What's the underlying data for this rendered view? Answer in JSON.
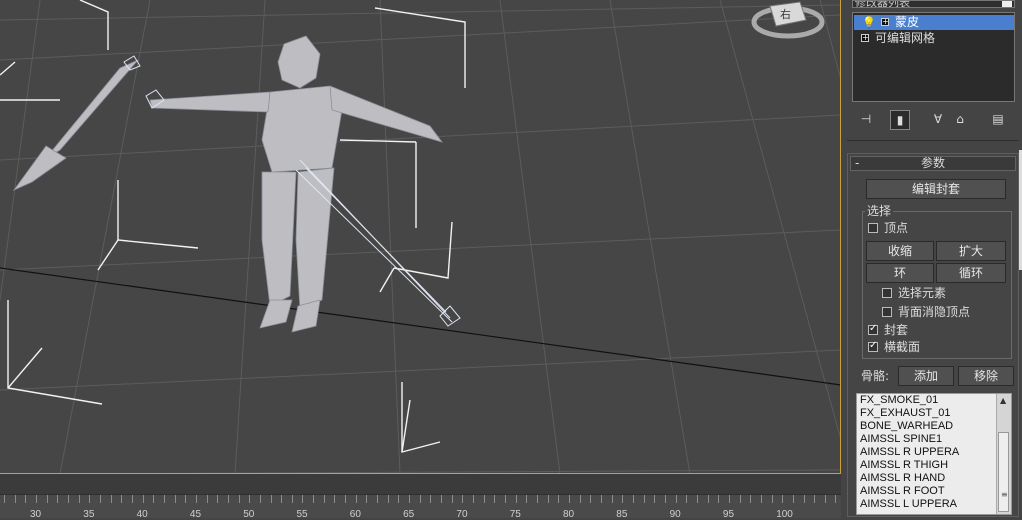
{
  "modifier_stack": {
    "list_header": "修改器列表",
    "items": [
      {
        "label": "蒙皮",
        "selected": true
      },
      {
        "label": "可编辑网格",
        "selected": false
      }
    ]
  },
  "stack_toolbar": {
    "icons": [
      "pin-stack-icon",
      "show-end-result-icon",
      "make-unique-icon",
      "remove-modifier-icon",
      "configure-sets-icon"
    ]
  },
  "rollout": {
    "collapse_symbol": "-",
    "title": "参数",
    "edit_envelope": "编辑封套",
    "selection_group": {
      "label": "选择",
      "vertex": {
        "label": "顶点",
        "checked": false
      },
      "shrink": "收缩",
      "grow": "扩大",
      "ring": "环",
      "loop": "循环",
      "select_element": {
        "label": "选择元素",
        "checked": false
      },
      "backface_cull": {
        "label": "背面消隐顶点",
        "checked": false
      },
      "envelope": {
        "label": "封套",
        "checked": true
      },
      "cross_section": {
        "label": "横截面",
        "checked": true
      }
    },
    "bones_label": "骨骼:",
    "add": "添加",
    "remove": "移除",
    "bones": [
      "FX_SMOKE_01",
      "FX_EXHAUST_01",
      "BONE_WARHEAD",
      "AIMSSL SPINE1",
      "AIMSSL R UPPERA",
      "AIMSSL R THIGH",
      "AIMSSL R HAND",
      "AIMSSL R FOOT",
      "AIMSSL L UPPERA"
    ]
  },
  "viewcube": {
    "label": "右"
  },
  "timeline": {
    "ticks": [
      "30",
      "35",
      "40",
      "45",
      "50",
      "55",
      "60",
      "65",
      "70",
      "75",
      "80",
      "85",
      "90",
      "95",
      "100"
    ]
  },
  "colors": {
    "selection": "#4a7fd0",
    "viewport_border": "#c9a23a"
  }
}
